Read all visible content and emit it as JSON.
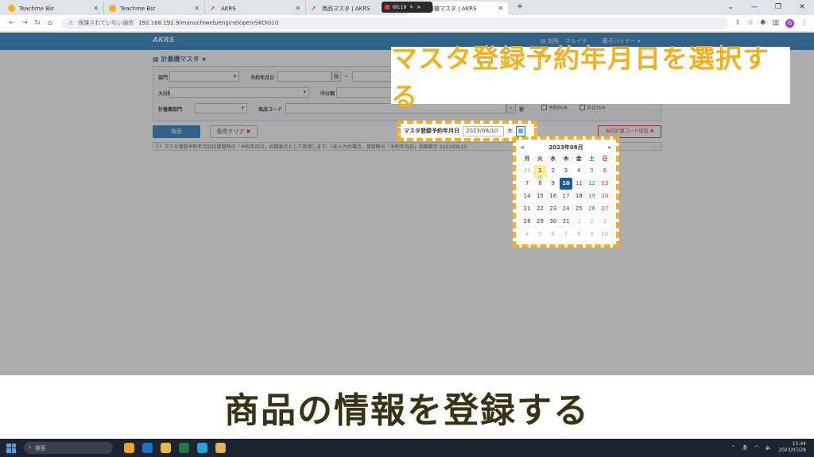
{
  "browser": {
    "tabs": [
      {
        "title": "Teachme Biz",
        "favicon": "teachme-icon"
      },
      {
        "title": "Teachme Biz",
        "favicon": "teachme-icon"
      },
      {
        "title": "AKRS",
        "favicon": "akrs-icon"
      },
      {
        "title": "商品マスタ | AKRS",
        "favicon": "akrs-icon"
      },
      {
        "title": "計量機マスタ | AKRS",
        "favicon": "akrs-icon"
      }
    ],
    "recording_time": "00:19",
    "security_label": "保護されていない通信",
    "url": "192.168.192.9/manuchiweb/engine/open/SKOI010",
    "profile_initial": "G"
  },
  "app": {
    "logo": "AKRS",
    "help_label": "説明",
    "user_company": "マルイチ",
    "user_role": "菓子バイヤー"
  },
  "page": {
    "title": "計量機マスタ",
    "filters": {
      "dept_label": "部門",
      "reserve_date_label": "予約年月日",
      "tilde": "~",
      "major_class_label": "大分類",
      "middle_class_label": "中分類",
      "scale_dept_label": "計量機部門",
      "product_code_label": "商品コード",
      "status_label_partial": "状",
      "reserved_only_label": "予約のみ",
      "stopped_only_label": "中止のみ"
    },
    "search_button": "検索",
    "clear_button": "条件クリア",
    "add_button": "当日計量コード追加",
    "info_text": "マスタ登録予約年月日は登録時の「予約年月日」初期表示として使用します。（未入力の場合、登録時の「予約年月日」初期表示 2023/08/10"
  },
  "date_field": {
    "label": "マスタ登録予約年月日",
    "value": "2023/08/10",
    "weekday": "木"
  },
  "calendar": {
    "month_label": "2023年08月",
    "prev": "«",
    "next": "»",
    "weekdays": [
      "月",
      "火",
      "水",
      "木",
      "金",
      "土",
      "日"
    ],
    "days": [
      {
        "d": "31",
        "t": "other"
      },
      {
        "d": "1",
        "t": "today"
      },
      {
        "d": "2",
        "t": ""
      },
      {
        "d": "3",
        "t": ""
      },
      {
        "d": "4",
        "t": ""
      },
      {
        "d": "5",
        "t": "sat"
      },
      {
        "d": "6",
        "t": "sun"
      },
      {
        "d": "7",
        "t": ""
      },
      {
        "d": "8",
        "t": ""
      },
      {
        "d": "9",
        "t": ""
      },
      {
        "d": "10",
        "t": "selected"
      },
      {
        "d": "11",
        "t": "sun"
      },
      {
        "d": "12",
        "t": "sat"
      },
      {
        "d": "13",
        "t": "sun"
      },
      {
        "d": "14",
        "t": ""
      },
      {
        "d": "15",
        "t": ""
      },
      {
        "d": "16",
        "t": ""
      },
      {
        "d": "17",
        "t": ""
      },
      {
        "d": "18",
        "t": ""
      },
      {
        "d": "19",
        "t": "sat"
      },
      {
        "d": "20",
        "t": "sun"
      },
      {
        "d": "21",
        "t": ""
      },
      {
        "d": "22",
        "t": ""
      },
      {
        "d": "23",
        "t": ""
      },
      {
        "d": "24",
        "t": ""
      },
      {
        "d": "25",
        "t": ""
      },
      {
        "d": "26",
        "t": "sat"
      },
      {
        "d": "27",
        "t": "sun"
      },
      {
        "d": "28",
        "t": ""
      },
      {
        "d": "29",
        "t": ""
      },
      {
        "d": "30",
        "t": ""
      },
      {
        "d": "31",
        "t": ""
      },
      {
        "d": "1",
        "t": "other"
      },
      {
        "d": "2",
        "t": "other"
      },
      {
        "d": "3",
        "t": "other"
      },
      {
        "d": "4",
        "t": "other"
      },
      {
        "d": "5",
        "t": "other"
      },
      {
        "d": "6",
        "t": "other"
      },
      {
        "d": "7",
        "t": "other"
      },
      {
        "d": "8",
        "t": "other"
      },
      {
        "d": "9",
        "t": "other"
      },
      {
        "d": "10",
        "t": "other"
      }
    ]
  },
  "callout_text": "マスタ登録予約年月日を選択する",
  "caption_text": "商品の情報を登録する",
  "taskbar": {
    "search_placeholder": "検索",
    "time": "15:44",
    "date": "2023/07/28",
    "ime": "あ"
  },
  "colors": {
    "accent": "#1e78c0",
    "highlight": "#f2b01e",
    "caption": "#3a3214"
  }
}
